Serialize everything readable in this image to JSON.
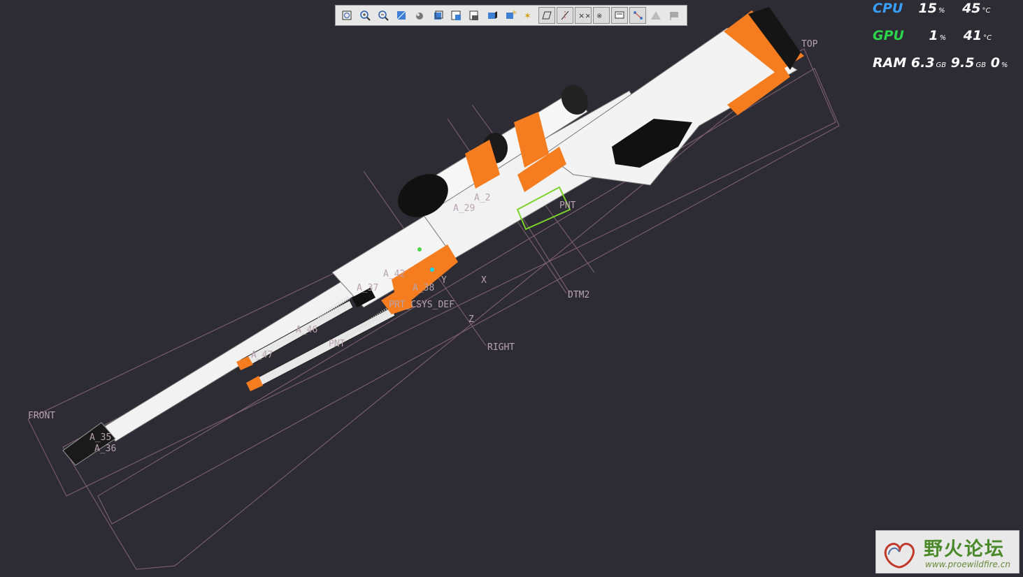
{
  "toolbar": {
    "buttons": [
      {
        "icon": "refit-icon",
        "boxed": false
      },
      {
        "icon": "zoom-in-icon",
        "boxed": false
      },
      {
        "icon": "zoom-out-icon",
        "boxed": false
      },
      {
        "icon": "repaint-icon",
        "boxed": false
      },
      {
        "icon": "display-style-icon",
        "boxed": false
      },
      {
        "icon": "saved-orientations-icon",
        "boxed": false
      },
      {
        "icon": "view-manager-icon",
        "boxed": false
      },
      {
        "icon": "layers-icon",
        "boxed": false
      },
      {
        "icon": "perspective-icon",
        "boxed": false
      },
      {
        "icon": "spin-center-icon",
        "boxed": false
      },
      {
        "icon": "annotation-display-icon",
        "boxed": false
      },
      {
        "icon": "plane-display-icon",
        "boxed": true
      },
      {
        "icon": "axis-display-icon",
        "boxed": true
      },
      {
        "icon": "point-display-icon",
        "boxed": true
      },
      {
        "icon": "csys-display-icon",
        "boxed": true
      },
      {
        "icon": "annotation-tag-icon",
        "boxed": true
      },
      {
        "icon": "sketch-display-icon",
        "boxed": true
      },
      {
        "icon": "simulation-icon",
        "boxed": false
      },
      {
        "icon": "flag-icon",
        "boxed": false
      }
    ]
  },
  "monitor": {
    "cpu": {
      "label": "CPU",
      "usage": "15",
      "usage_unit": "%",
      "temp": "45",
      "temp_unit": "°C"
    },
    "gpu": {
      "label": "GPU",
      "usage": "1",
      "usage_unit": "%",
      "temp": "41",
      "temp_unit": "°C"
    },
    "ram": {
      "label": "RAM",
      "used": "6.3",
      "used_unit": "GB",
      "total": "9.5",
      "total_unit": "GB",
      "percent": "0",
      "percent_unit": "%"
    }
  },
  "model": {
    "datums": {
      "top": "TOP",
      "front": "FRONT",
      "right": "RIGHT",
      "dtm2": "DTM2",
      "csys": "PRT_CSYS_DEF"
    },
    "axes": {
      "x": "X",
      "y": "Y",
      "z": "Z"
    },
    "axis_labels": {
      "a29": "A_29",
      "a2": "A_2",
      "a42": "A_42",
      "a38": "A_38",
      "a37": "A_37",
      "a46": "A_46",
      "a47": "A_47",
      "a36": "A_36",
      "a35": "A_35",
      "pnt": "PNT",
      "pnt2": "PNT"
    },
    "colors": {
      "body": "#f2f2f2",
      "accent": "#f57c1f",
      "black": "#111111",
      "datum": "#b08a98",
      "background": "#2d2c34"
    }
  },
  "watermark": {
    "title": "野火论坛",
    "url": "www.proewildfire.cn"
  }
}
